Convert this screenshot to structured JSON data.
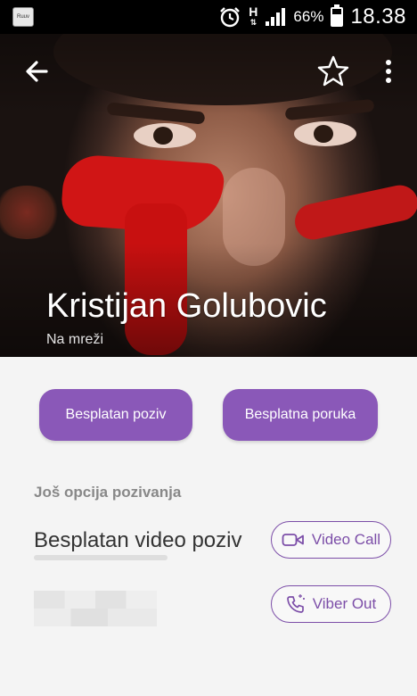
{
  "status_bar": {
    "app_icon_text": "Ruuv",
    "battery_percent": "66%",
    "time": "18.38",
    "network_type": "H"
  },
  "header": {
    "contact_name": "Kristijan Golubovic",
    "status": "Na mreži"
  },
  "actions": {
    "free_call": "Besplatan poziv",
    "free_message": "Besplatna poruka"
  },
  "more_options": {
    "title": "Još opcija pozivanja",
    "video_label": "Besplatan video poziv",
    "video_call_button": "Video Call",
    "viber_out_button": "Viber Out"
  },
  "colors": {
    "accent": "#8a58b8",
    "outline": "#7c4ea8"
  }
}
